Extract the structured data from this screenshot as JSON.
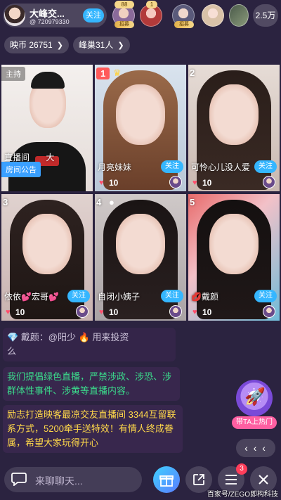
{
  "host": {
    "name": "大峰交...",
    "id": "@ 720979330",
    "follow_label": "关注"
  },
  "viewers": [
    {
      "badge": "88",
      "tag": "招募"
    },
    {
      "badge": "1",
      "tag": ""
    },
    {
      "badge": "",
      "tag": "招募"
    },
    {
      "badge": "",
      "tag": ""
    },
    {
      "badge": "",
      "tag": ""
    }
  ],
  "viewer_count": "2.5万",
  "stats": {
    "coins_label": "映币 26751",
    "nest_label": "峰巢31人"
  },
  "seats": [
    {
      "label": "主持",
      "name": "直播间",
      "name_suffix": "大",
      "notice": "房间公告"
    },
    {
      "num": "1",
      "name": "月亮妹妹",
      "follow": "关注",
      "score": "10"
    },
    {
      "num": "2",
      "name": "可怜心儿没人爱",
      "follow": "关注",
      "score": "10"
    },
    {
      "num": "3",
      "name": "依依💕宏哥💕",
      "follow": "关注",
      "score": "10"
    },
    {
      "num": "4",
      "name": "自闭小姨子",
      "follow": "关注",
      "score": "10"
    },
    {
      "num": "5",
      "name": "💋戴颜",
      "follow": "关注",
      "score": "10"
    }
  ],
  "chat": {
    "faded_line": "💎 戴颜：@阳少 🔥 用来投资",
    "faded_line2": "么",
    "notice_green": "我们提倡绿色直播，严禁涉政、涉恐、涉群体性事件、涉黄等直播内容。",
    "notice_yellow": "励志打造映客最凉交友直播间 3344互留联系方式，5200牵手送特效！有情人终成眷属，希望大家玩得开心"
  },
  "promo_label": "带TA上热门",
  "collapse_label": "‹ ‹ ‹",
  "input_placeholder": "来聊聊天...",
  "msg_badge": "3",
  "watermark": "百家号/ZEGO即构科技"
}
